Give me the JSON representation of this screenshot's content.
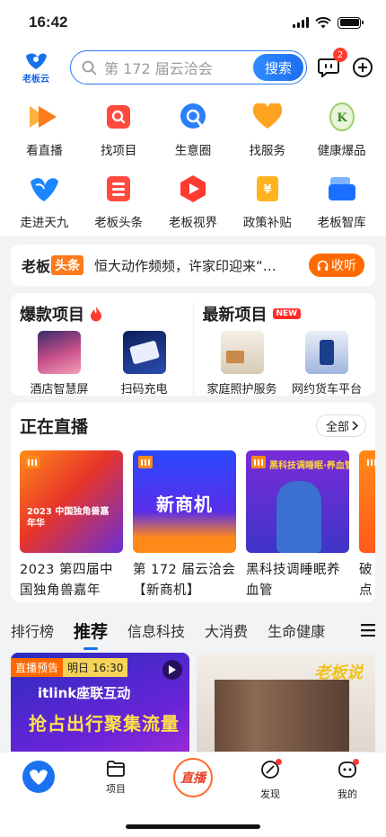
{
  "status_bar": {
    "time": "16:42"
  },
  "header": {
    "logo_text": "老板云",
    "search_placeholder": "第 172 届云洽会",
    "search_button": "搜索",
    "message_badge": "2"
  },
  "grid": [
    {
      "label": "看直播",
      "icon": "play-icon"
    },
    {
      "label": "找项目",
      "icon": "project-search-icon"
    },
    {
      "label": "生意圈",
      "icon": "chat-bubble-icon"
    },
    {
      "label": "找服务",
      "icon": "heart-icon"
    },
    {
      "label": "健康爆品",
      "icon": "health-badge-icon"
    },
    {
      "label": "走进天九",
      "icon": "bird-logo-icon"
    },
    {
      "label": "老板头条",
      "icon": "news-icon"
    },
    {
      "label": "老板视界",
      "icon": "vision-icon"
    },
    {
      "label": "政策补贴",
      "icon": "subsidy-icon"
    },
    {
      "label": "老板智库",
      "icon": "folder-icon"
    }
  ],
  "ticker": {
    "brand": "老板",
    "tag": "头条",
    "text": "恒大动作频频，许家印迎来“…",
    "follow_label": "收听"
  },
  "projects": {
    "hot_title": "爆款项目",
    "new_title": "最新项目",
    "new_tag": "NEW",
    "hot_items": [
      {
        "label": "酒店智慧屏"
      },
      {
        "label": "扫码充电"
      }
    ],
    "new_items": [
      {
        "label": "家庭照护服务"
      },
      {
        "label": "网约货车平台"
      }
    ]
  },
  "live": {
    "title": "正在直播",
    "all_label": "全部",
    "cards": [
      {
        "caption": "2023 第四届中国独角兽嘉年",
        "thumb_text": "2023 中国独角兽嘉年华"
      },
      {
        "caption": "第 172 届云洽会【新商机】",
        "thumb_text": "新商机"
      },
      {
        "caption": "黑科技调睡眠养血管",
        "thumb_text": "黑科技调睡眠·养血管"
      },
      {
        "caption": "破点",
        "thumb_text": ""
      }
    ]
  },
  "tabs": [
    "排行榜",
    "推荐",
    "信息科技",
    "大消费",
    "生命健康"
  ],
  "active_tab": "推荐",
  "feed": {
    "left": {
      "tag_a": "直播预告",
      "tag_b": "明日 16:30",
      "brand": "itlink座联互动",
      "headline": "抢占出行聚集流量"
    },
    "right": {
      "logo": "老板说"
    }
  },
  "bottom_nav": [
    {
      "label": "",
      "name": "home"
    },
    {
      "label": "项目",
      "name": "projects"
    },
    {
      "label": "直播",
      "name": "live"
    },
    {
      "label": "发现",
      "name": "discover"
    },
    {
      "label": "我的",
      "name": "mine"
    }
  ]
}
